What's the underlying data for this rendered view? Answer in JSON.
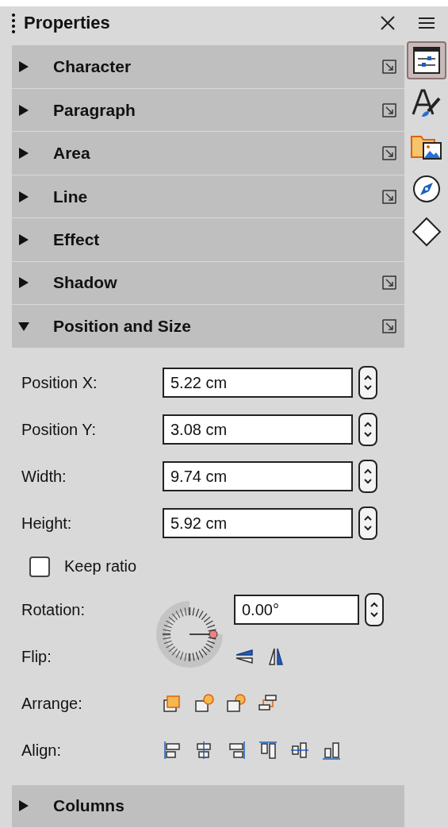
{
  "panel": {
    "title": "Properties"
  },
  "sections": [
    {
      "title": "Character",
      "expanded": false,
      "more_options": true
    },
    {
      "title": "Paragraph",
      "expanded": false,
      "more_options": true
    },
    {
      "title": "Area",
      "expanded": false,
      "more_options": true
    },
    {
      "title": "Line",
      "expanded": false,
      "more_options": true
    },
    {
      "title": "Effect",
      "expanded": false,
      "more_options": false
    },
    {
      "title": "Shadow",
      "expanded": false,
      "more_options": true
    },
    {
      "title": "Position and Size",
      "expanded": true,
      "more_options": true
    }
  ],
  "position_and_size": {
    "fields": [
      {
        "label": "Position X:",
        "value": "5.22 cm"
      },
      {
        "label": "Position Y:",
        "value": "3.08 cm"
      },
      {
        "label": "Width:",
        "value": "9.74 cm"
      },
      {
        "label": "Height:",
        "value": "5.92 cm"
      }
    ],
    "keep_ratio": {
      "label": "Keep ratio",
      "checked": false
    },
    "rotation": {
      "label": "Rotation:",
      "value": "0.00°"
    },
    "flip": {
      "label": "Flip:"
    },
    "arrange": {
      "label": "Arrange:"
    },
    "align": {
      "label": "Align:"
    }
  },
  "trailing_sections": [
    {
      "title": "Columns",
      "expanded": false
    }
  ],
  "deck_tabs": [
    {
      "kind": "properties",
      "selected": true
    },
    {
      "kind": "styles",
      "selected": false
    },
    {
      "kind": "gallery",
      "selected": false
    },
    {
      "kind": "navigator",
      "selected": false
    },
    {
      "kind": "shapes",
      "selected": false
    }
  ]
}
